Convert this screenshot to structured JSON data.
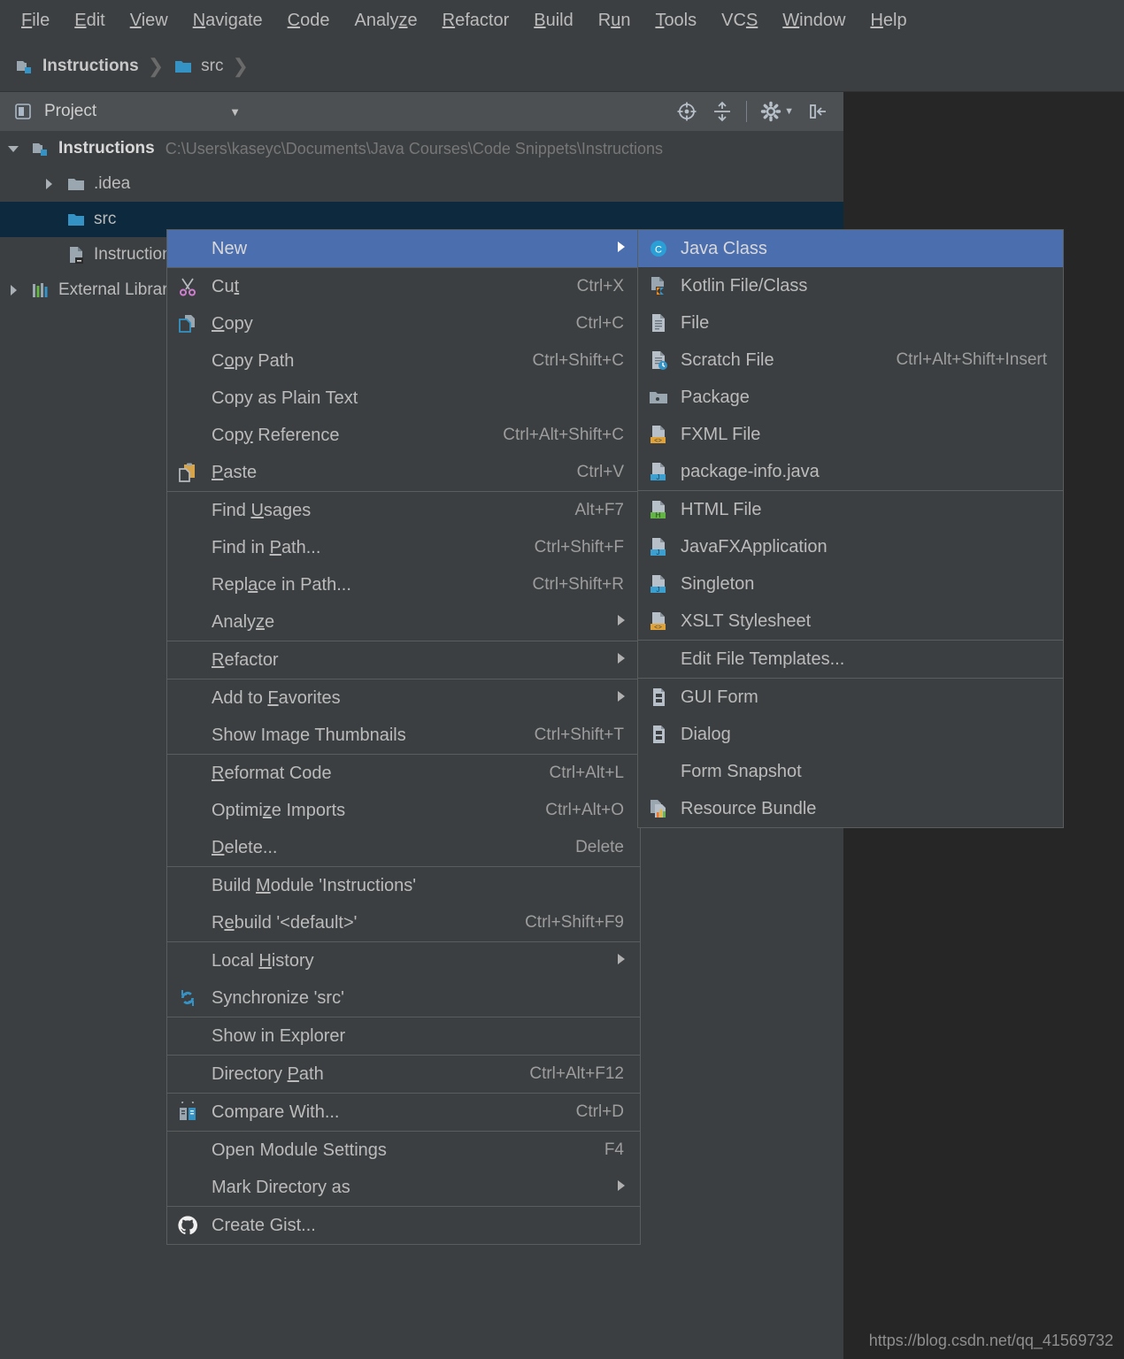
{
  "app": {
    "theme_bg": "#3c3f41",
    "canvas_bg": "#262626",
    "accent_blue": "#4b6eaf",
    "selection_blue": "#0d293e",
    "text_color": "#bbbbbb"
  },
  "menubar": {
    "items": [
      {
        "label": "File",
        "mnemonic": "F"
      },
      {
        "label": "Edit",
        "mnemonic": "E"
      },
      {
        "label": "View",
        "mnemonic": "V"
      },
      {
        "label": "Navigate",
        "mnemonic": "N"
      },
      {
        "label": "Code",
        "mnemonic": "C"
      },
      {
        "label": "Analyze",
        "mnemonic": "z"
      },
      {
        "label": "Refactor",
        "mnemonic": "R"
      },
      {
        "label": "Build",
        "mnemonic": "B"
      },
      {
        "label": "Run",
        "mnemonic": "u"
      },
      {
        "label": "Tools",
        "mnemonic": "T"
      },
      {
        "label": "VCS",
        "mnemonic": "S"
      },
      {
        "label": "Window",
        "mnemonic": "W"
      },
      {
        "label": "Help",
        "mnemonic": "H"
      }
    ]
  },
  "breadcrumb": {
    "items": [
      {
        "label": "Instructions",
        "icon": "module-icon"
      },
      {
        "label": "src",
        "icon": "folder-icon"
      }
    ]
  },
  "project_panel": {
    "title": "Project",
    "tools": [
      {
        "name": "locate-icon"
      },
      {
        "name": "collapse-all-icon"
      },
      {
        "name": "settings-gear-icon"
      },
      {
        "name": "hide-panel-icon"
      }
    ]
  },
  "tree": {
    "rows": [
      {
        "label": "Instructions",
        "path": "C:\\Users\\kaseyc\\Documents\\Java Courses\\Code Snippets\\Instructions",
        "icon": "module-icon",
        "arrow": "down",
        "indent": 0,
        "selected": false,
        "bold": true
      },
      {
        "label": ".idea",
        "path": "",
        "icon": "folder-grey-icon",
        "arrow": "right",
        "indent": 1,
        "selected": false,
        "bold": false
      },
      {
        "label": "src",
        "path": "",
        "icon": "folder-blue-icon",
        "arrow": "none",
        "indent": 1,
        "selected": true,
        "bold": false
      },
      {
        "label": "Instructions.iml",
        "path": "",
        "icon": "iml-file-icon",
        "arrow": "none",
        "indent": 1,
        "selected": false,
        "bold": false
      },
      {
        "label": "External Libraries",
        "path": "",
        "icon": "libraries-icon",
        "arrow": "right",
        "indent": 0,
        "selected": false,
        "bold": false
      }
    ]
  },
  "context_menu": {
    "items": [
      {
        "type": "item",
        "label": "New",
        "mnemonic": "",
        "shortcut": "",
        "icon": "",
        "submenu": true,
        "highlight": true
      },
      {
        "type": "sep"
      },
      {
        "type": "item",
        "label": "Cut",
        "mnemonic": "t",
        "shortcut": "Ctrl+X",
        "icon": "cut-icon",
        "submenu": false
      },
      {
        "type": "item",
        "label": "Copy",
        "mnemonic": "C",
        "shortcut": "Ctrl+C",
        "icon": "copy-icon",
        "submenu": false
      },
      {
        "type": "item",
        "label": "Copy Path",
        "mnemonic": "o",
        "shortcut": "Ctrl+Shift+C",
        "icon": "",
        "submenu": false
      },
      {
        "type": "item",
        "label": "Copy as Plain Text",
        "mnemonic": "",
        "shortcut": "",
        "icon": "",
        "submenu": false
      },
      {
        "type": "item",
        "label": "Copy Reference",
        "mnemonic": "y",
        "shortcut": "Ctrl+Alt+Shift+C",
        "icon": "",
        "submenu": false
      },
      {
        "type": "item",
        "label": "Paste",
        "mnemonic": "P",
        "shortcut": "Ctrl+V",
        "icon": "paste-icon",
        "submenu": false
      },
      {
        "type": "sep"
      },
      {
        "type": "item",
        "label": "Find Usages",
        "mnemonic": "U",
        "shortcut": "Alt+F7",
        "icon": "",
        "submenu": false
      },
      {
        "type": "item",
        "label": "Find in Path...",
        "mnemonic": "P",
        "shortcut": "Ctrl+Shift+F",
        "icon": "",
        "submenu": false
      },
      {
        "type": "item",
        "label": "Replace in Path...",
        "mnemonic": "a",
        "shortcut": "Ctrl+Shift+R",
        "icon": "",
        "submenu": false
      },
      {
        "type": "item",
        "label": "Analyze",
        "mnemonic": "z",
        "shortcut": "",
        "icon": "",
        "submenu": true
      },
      {
        "type": "sep"
      },
      {
        "type": "item",
        "label": "Refactor",
        "mnemonic": "R",
        "shortcut": "",
        "icon": "",
        "submenu": true
      },
      {
        "type": "sep"
      },
      {
        "type": "item",
        "label": "Add to Favorites",
        "mnemonic": "F",
        "shortcut": "",
        "icon": "",
        "submenu": true
      },
      {
        "type": "item",
        "label": "Show Image Thumbnails",
        "mnemonic": "",
        "shortcut": "Ctrl+Shift+T",
        "icon": "",
        "submenu": false
      },
      {
        "type": "sep"
      },
      {
        "type": "item",
        "label": "Reformat Code",
        "mnemonic": "R",
        "shortcut": "Ctrl+Alt+L",
        "icon": "",
        "submenu": false
      },
      {
        "type": "item",
        "label": "Optimize Imports",
        "mnemonic": "z",
        "shortcut": "Ctrl+Alt+O",
        "icon": "",
        "submenu": false
      },
      {
        "type": "item",
        "label": "Delete...",
        "mnemonic": "D",
        "shortcut": "Delete",
        "icon": "",
        "submenu": false
      },
      {
        "type": "sep"
      },
      {
        "type": "item",
        "label": "Build Module 'Instructions'",
        "mnemonic": "M",
        "shortcut": "",
        "icon": "",
        "submenu": false
      },
      {
        "type": "item",
        "label": "Rebuild '<default>'",
        "mnemonic": "e",
        "shortcut": "Ctrl+Shift+F9",
        "icon": "",
        "submenu": false
      },
      {
        "type": "sep"
      },
      {
        "type": "item",
        "label": "Local History",
        "mnemonic": "H",
        "shortcut": "",
        "icon": "",
        "submenu": true
      },
      {
        "type": "item",
        "label": "Synchronize 'src'",
        "mnemonic": "",
        "shortcut": "",
        "icon": "synchronize-icon",
        "submenu": false
      },
      {
        "type": "sep"
      },
      {
        "type": "item",
        "label": "Show in Explorer",
        "mnemonic": "",
        "shortcut": "",
        "icon": "",
        "submenu": false
      },
      {
        "type": "sep"
      },
      {
        "type": "item",
        "label": "Directory Path",
        "mnemonic": "P",
        "shortcut": "Ctrl+Alt+F12",
        "icon": "",
        "submenu": false
      },
      {
        "type": "sep"
      },
      {
        "type": "item",
        "label": "Compare With...",
        "mnemonic": "",
        "shortcut": "Ctrl+D",
        "icon": "compare-icon",
        "submenu": false
      },
      {
        "type": "sep"
      },
      {
        "type": "item",
        "label": "Open Module Settings",
        "mnemonic": "",
        "shortcut": "F4",
        "icon": "",
        "submenu": false
      },
      {
        "type": "item",
        "label": "Mark Directory as",
        "mnemonic": "",
        "shortcut": "",
        "icon": "",
        "submenu": true
      },
      {
        "type": "sep"
      },
      {
        "type": "item",
        "label": "Create Gist...",
        "mnemonic": "",
        "shortcut": "",
        "icon": "github-icon",
        "submenu": false
      }
    ]
  },
  "new_submenu": {
    "items": [
      {
        "type": "item",
        "label": "Java Class",
        "shortcut": "",
        "icon": "java-class-icon",
        "highlight": true
      },
      {
        "type": "item",
        "label": "Kotlin File/Class",
        "shortcut": "",
        "icon": "kotlin-file-icon",
        "highlight": false
      },
      {
        "type": "item",
        "label": "File",
        "shortcut": "",
        "icon": "file-icon",
        "highlight": false
      },
      {
        "type": "item",
        "label": "Scratch File",
        "shortcut": "Ctrl+Alt+Shift+Insert",
        "icon": "scratch-file-icon",
        "highlight": false
      },
      {
        "type": "item",
        "label": "Package",
        "shortcut": "",
        "icon": "package-icon",
        "highlight": false
      },
      {
        "type": "item",
        "label": "FXML File",
        "shortcut": "",
        "icon": "fxml-file-icon",
        "highlight": false
      },
      {
        "type": "item",
        "label": "package-info.java",
        "shortcut": "",
        "icon": "java-file-icon",
        "highlight": false
      },
      {
        "type": "sep"
      },
      {
        "type": "item",
        "label": "HTML File",
        "shortcut": "",
        "icon": "html-file-icon",
        "highlight": false
      },
      {
        "type": "item",
        "label": "JavaFXApplication",
        "shortcut": "",
        "icon": "java-file-icon",
        "highlight": false
      },
      {
        "type": "item",
        "label": "Singleton",
        "shortcut": "",
        "icon": "java-file-icon",
        "highlight": false
      },
      {
        "type": "item",
        "label": "XSLT Stylesheet",
        "shortcut": "",
        "icon": "xslt-file-icon",
        "highlight": false
      },
      {
        "type": "sep"
      },
      {
        "type": "item",
        "label": "Edit File Templates...",
        "shortcut": "",
        "icon": "",
        "highlight": false
      },
      {
        "type": "sep"
      },
      {
        "type": "item",
        "label": "GUI Form",
        "shortcut": "",
        "icon": "gui-form-icon",
        "highlight": false
      },
      {
        "type": "item",
        "label": "Dialog",
        "shortcut": "",
        "icon": "gui-form-icon",
        "highlight": false
      },
      {
        "type": "item",
        "label": "Form Snapshot",
        "shortcut": "",
        "icon": "",
        "highlight": false
      },
      {
        "type": "item",
        "label": "Resource Bundle",
        "shortcut": "",
        "icon": "resource-bundle-icon",
        "highlight": false
      }
    ]
  },
  "watermark": {
    "text": "https://blog.csdn.net/qq_41569732"
  }
}
